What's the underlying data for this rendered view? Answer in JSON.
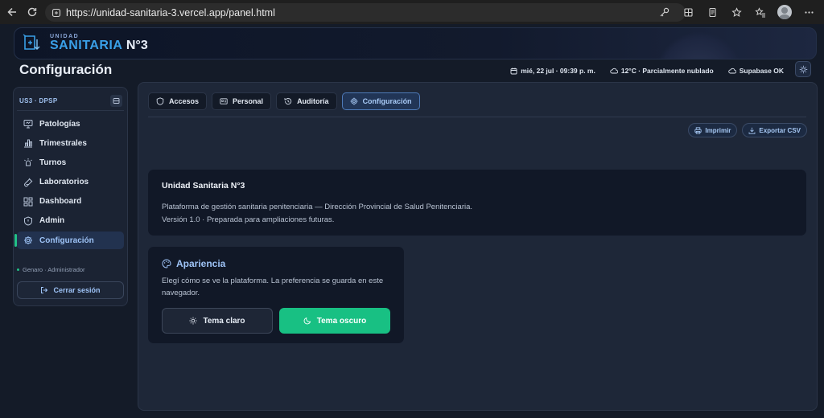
{
  "browser": {
    "url": "https://unidad-sanitaria-3.vercel.app/panel.html"
  },
  "banner": {
    "logo_small": "UNIDAD",
    "logo_word": "SANITARIA",
    "logo_number": "N°3"
  },
  "header": {
    "title": "Configuración",
    "date": "mié, 22 jul · 09:39 p. m.",
    "weather": "12°C · Parcialmente nublado",
    "db_status": "Supabase OK"
  },
  "sidebar": {
    "brand": "US3 · DPSP",
    "items": [
      {
        "label": "Patologías",
        "icon": "monitor-icon"
      },
      {
        "label": "Trimestrales",
        "icon": "bar-chart-icon"
      },
      {
        "label": "Turnos",
        "icon": "alarm-icon"
      },
      {
        "label": "Laboratorios",
        "icon": "flask-icon"
      },
      {
        "label": "Dashboard",
        "icon": "grid-icon"
      },
      {
        "label": "Admin",
        "icon": "shield-icon"
      },
      {
        "label": "Configuración",
        "icon": "gear-icon",
        "active": true
      }
    ],
    "user": "Genaro · Administrador",
    "logout": "Cerrar sesión"
  },
  "tabs": [
    {
      "label": "Accesos",
      "icon": "shield-icon"
    },
    {
      "label": "Personal",
      "icon": "id-card-icon"
    },
    {
      "label": "Auditoría",
      "icon": "history-icon"
    },
    {
      "label": "Configuración",
      "icon": "gear-icon",
      "active": true
    }
  ],
  "actions": {
    "print": "Imprimir",
    "export": "Exportar CSV"
  },
  "info": {
    "title": "Unidad Sanitaria N°3",
    "line1": "Plataforma de gestión sanitaria penitenciaria — Dirección Provincial de Salud Penitenciaria.",
    "line2": "Versión 1.0 · Preparada para ampliaciones futuras."
  },
  "appearance": {
    "title": "Apariencia",
    "description": "Elegí cómo se ve la plataforma. La preferencia se guarda en este navegador.",
    "light_label": "Tema claro",
    "dark_label": "Tema oscuro"
  },
  "colors": {
    "accent": "#18c083",
    "primary_text": "#9ec3f6",
    "background": "#141b28"
  }
}
